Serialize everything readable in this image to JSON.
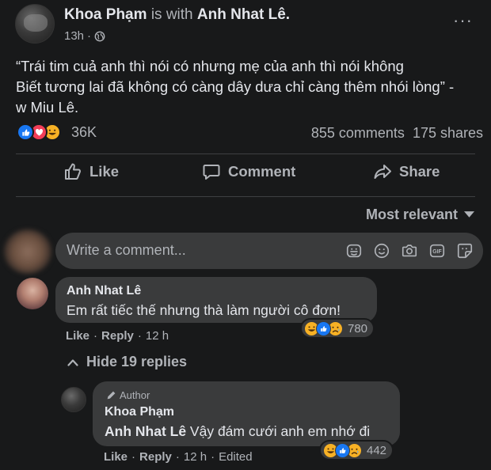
{
  "post": {
    "author": "Khoa Phạm",
    "with_text": "is with",
    "tagged": "Anh Nhat Lê.",
    "time": "13h",
    "dot": "·",
    "more": "···",
    "text_lines": [
      "“Trái tim cuả anh thì nói có nhưng mẹ của anh thì nói không",
      "Biết tương lai đã không có càng dây dưa chỉ càng thêm nhói lòng” -",
      "w Miu Lê."
    ],
    "reaction_count": "36K",
    "comments": "855 comments",
    "shares": "175 shares"
  },
  "actions": {
    "like": "Like",
    "comment": "Comment",
    "share": "Share"
  },
  "sort": {
    "label": "Most relevant"
  },
  "composer": {
    "placeholder": "Write a comment..."
  },
  "comment1": {
    "name": "Anh Nhat Lê",
    "text": "Em rất tiếc thế nhưng thà làm người cô đơn!",
    "reaction_count": "780",
    "like": "Like",
    "reply": "Reply",
    "time": "12 h",
    "sep": "·"
  },
  "hide_replies": "Hide 19 replies",
  "reply1": {
    "badge": "Author",
    "name": "Khoa Phạm",
    "mention": "Anh Nhat Lê",
    "text": " Vậy đám cưới anh em nhớ đi",
    "reaction_count": "442",
    "like": "Like",
    "reply": "Reply",
    "time": "12 h",
    "edited": "Edited",
    "sep": "·"
  },
  "colors": {
    "background": "#18191a",
    "bubble": "#3a3b3c",
    "text_primary": "#e4e6eb",
    "text_secondary": "#b0b3b8",
    "like_blue": "#1877f2",
    "love_red": "#f33e58",
    "emoji_yellow": "#f7b125"
  }
}
